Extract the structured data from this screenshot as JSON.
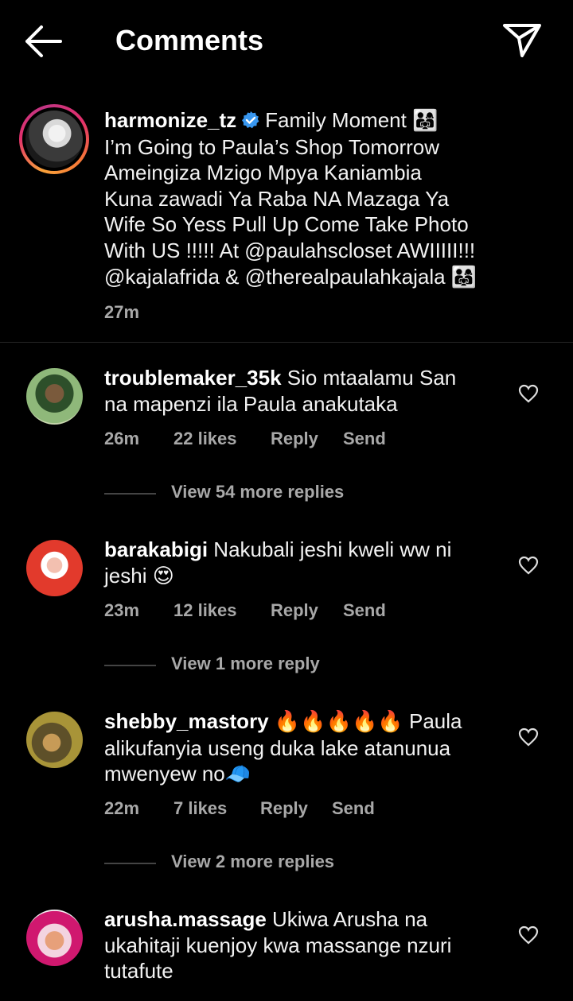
{
  "header": {
    "title": "Comments",
    "back_icon": "arrow-left-icon",
    "share_icon": "paper-plane-icon"
  },
  "post": {
    "username": "harmonize_tz",
    "verified": true,
    "caption_line1": "Family Moment",
    "emoji_family": "👨‍👩‍👧",
    "caption_rest": [
      "I’m Going to Paula’s Shop Tomorrow",
      "Ameingiza Mzigo Mpya  Kaniambia",
      "Kuna zawadi Ya Raba NA Mazaga Ya",
      "Wife So Yess Pull Up Come Take Photo",
      "With  US !!!!! At @paulahscloset  AWIIIII!!!",
      "@kajalafrida & @therealpaulahkajala"
    ],
    "time": "27m"
  },
  "comments": [
    {
      "username": "troublemaker_35k",
      "text_line1": "Sio mtaalamu San",
      "text_rest": "na mapenzi ila Paula anakutaka",
      "time": "26m",
      "likes": "22 likes",
      "reply": "Reply",
      "send": "Send",
      "view_more": "View 54 more replies"
    },
    {
      "username": "barakabigi",
      "text_line1": "Nakubali jeshi kweli ww ni",
      "text_rest": "jeshi",
      "emoji": "😍",
      "time": "23m",
      "likes": "12 likes",
      "reply": "Reply",
      "send": "Send",
      "view_more": "View 1 more reply"
    },
    {
      "username": "shebby_mastory",
      "emoji_line1": "🔥🔥🔥🔥🔥",
      "text_line1": "Paula",
      "text_line2": "alikufanyia useng duka lake atanunua",
      "text_line3": "mwenyew no",
      "emoji_end": "🧢",
      "time": "22m",
      "likes": "7 likes",
      "reply": "Reply",
      "send": "Send",
      "view_more": "View 2 more replies"
    },
    {
      "username": "arusha.massage",
      "text_line1": "Ukiwa Arusha na",
      "text_line2": "ukahitaji kuenjoy kwa massange nzuri",
      "text_line3": "tutafute"
    }
  ],
  "colors": {
    "background": "#000000",
    "text": "#f5f5f5",
    "meta": "#a8a8a8",
    "verified": "#3897f0"
  }
}
